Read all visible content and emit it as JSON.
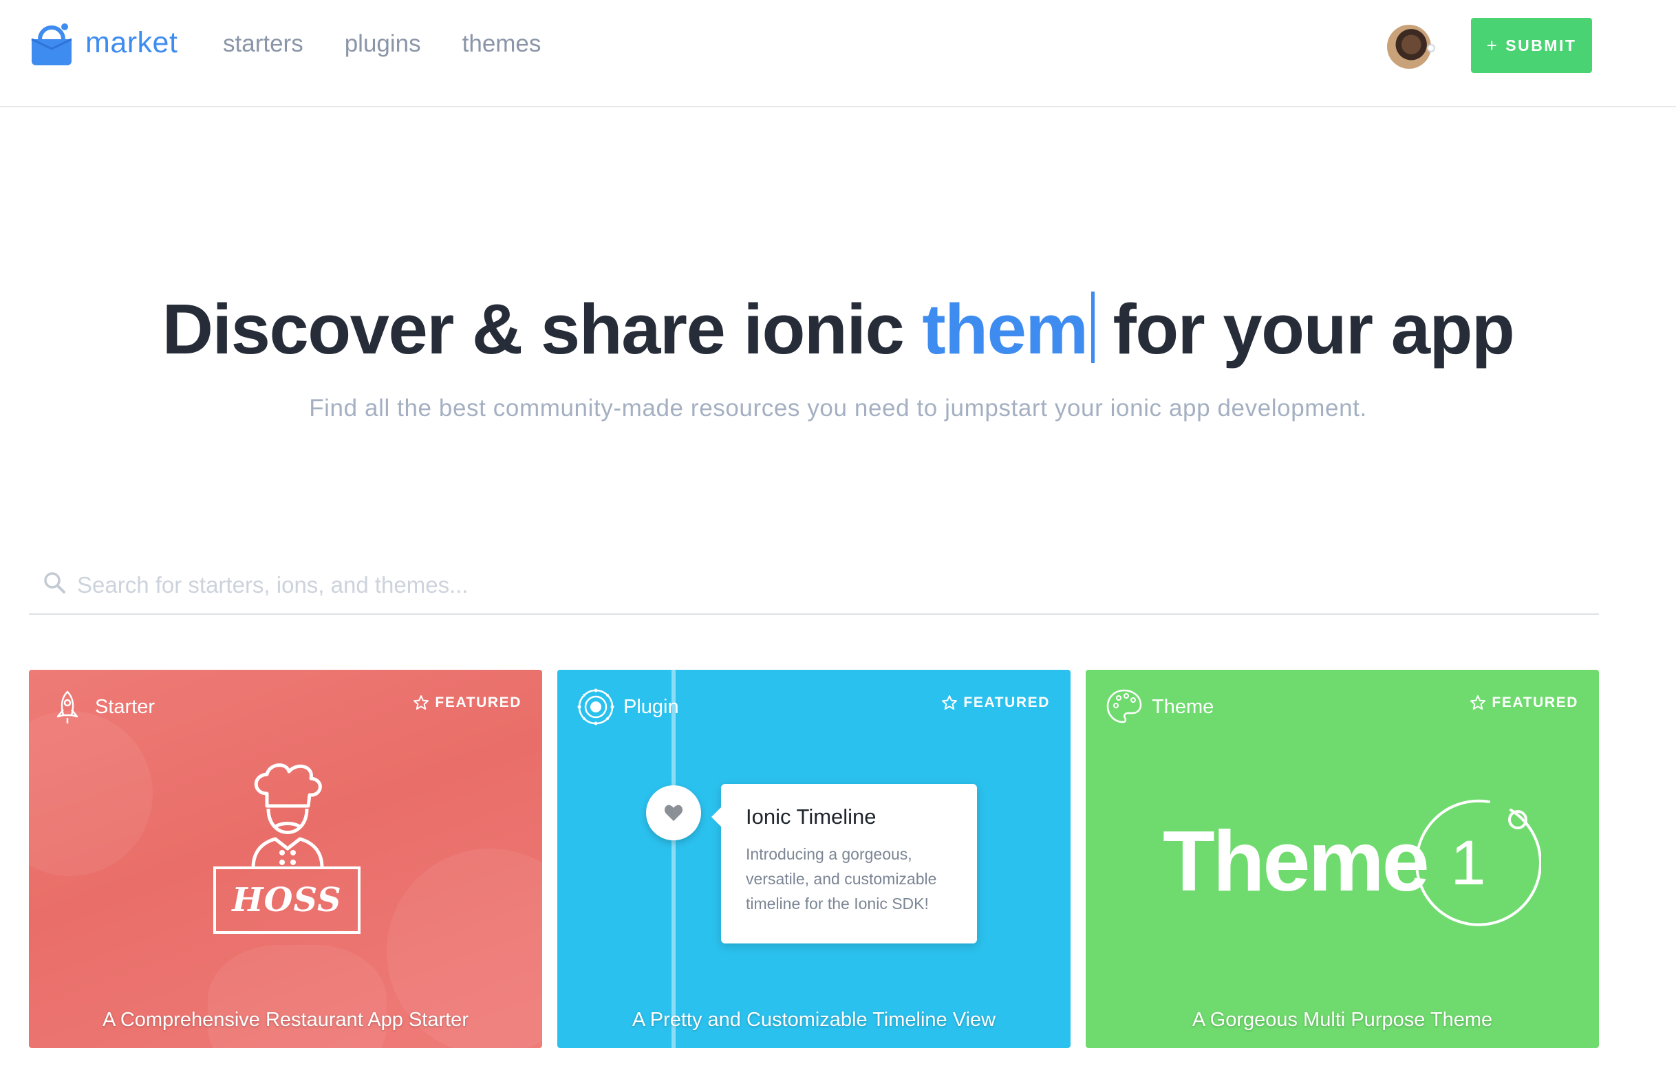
{
  "header": {
    "logo_text": "market",
    "nav": [
      {
        "label": "starters"
      },
      {
        "label": "plugins"
      },
      {
        "label": "themes"
      }
    ],
    "submit_plus": "+",
    "submit_label": "SUBMIT",
    "brand_color": "#3f8cf0",
    "submit_color": "#49d372"
  },
  "hero": {
    "title_before": "Discover & share ionic",
    "title_typed": "them",
    "title_after": "for your app",
    "subtitle": "Find all the best community-made resources you need to jumpstart your ionic app development."
  },
  "search": {
    "placeholder": "Search for starters, ions, and themes...",
    "value": "",
    "icon": "search-icon"
  },
  "cards": [
    {
      "type": "Starter",
      "type_icon": "rocket-icon",
      "featured": "FEATURED",
      "featured_icon": "star-icon",
      "art_text": "HOSS",
      "description": "A Comprehensive Restaurant App Starter",
      "color": "#ec7471"
    },
    {
      "type": "Plugin",
      "type_icon": "plugin-target-icon",
      "featured": "FEATURED",
      "featured_icon": "star-icon",
      "art_title": "Ionic Timeline",
      "art_body": "Introducing a gorgeous, versatile, and  customizable timeline for the Ionic SDK!",
      "description": "A Pretty and Customizable Timeline View",
      "color": "#2bc1ee"
    },
    {
      "type": "Theme",
      "type_icon": "palette-icon",
      "featured": "FEATURED",
      "featured_icon": "star-icon",
      "art_word": "Theme",
      "art_number": "1",
      "description": "A Gorgeous Multi Purpose Theme",
      "color": "#6fdb6e"
    }
  ]
}
